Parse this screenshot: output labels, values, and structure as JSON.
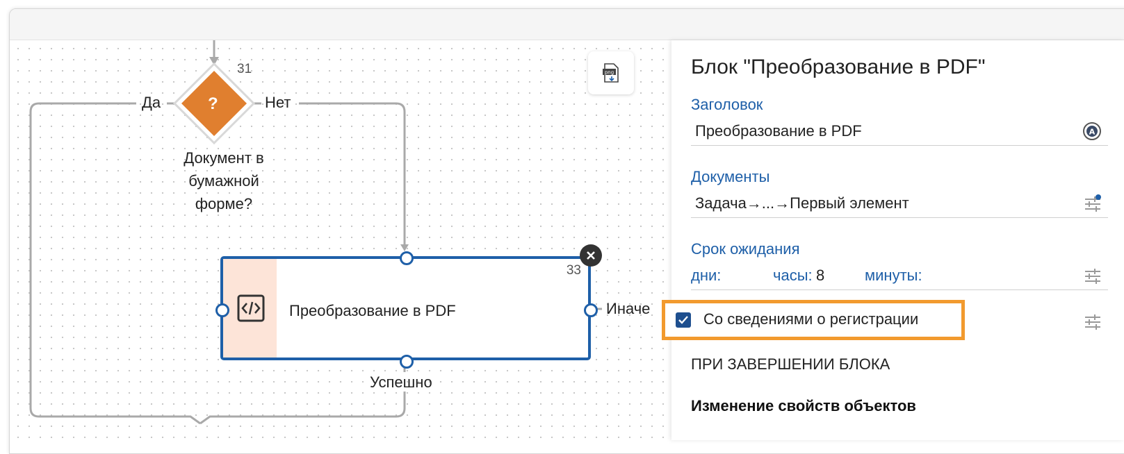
{
  "diagram": {
    "condition": {
      "number": "31",
      "symbol": "?",
      "label": "Документ в бумажной форме?",
      "yes_label": "Да",
      "no_label": "Нет",
      "color": "#e07f2f"
    },
    "block": {
      "number": "33",
      "title": "Преобразование в PDF",
      "else_label": "Иначе",
      "success_label": "Успешно",
      "icon": "code-icon",
      "accent_color": "#1e5fa8"
    },
    "export_button_icon": "png-export-icon"
  },
  "properties": {
    "title": "Блок \"Преобразование в PDF\"",
    "heading_label": "Заголовок",
    "heading_value": "Преобразование в PDF",
    "documents_label": "Документы",
    "documents_value": "Задача→...→Первый элемент",
    "timeout_label": "Срок ожидания",
    "days_label": "дни:",
    "hours_label": "часы:",
    "hours_value": "8",
    "minutes_label": "минуты:",
    "registration_checkbox": {
      "label": "Со сведениями о регистрации",
      "checked": true,
      "highlight_color": "#f29a2e"
    },
    "on_complete_header": "ПРИ ЗАВЕРШЕНИИ БЛОКА",
    "change_props_header": "Изменение свойств объектов"
  }
}
